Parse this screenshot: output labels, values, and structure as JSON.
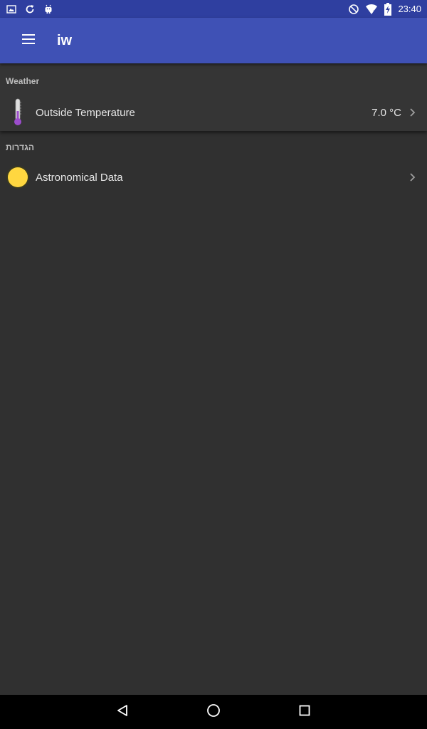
{
  "status_bar": {
    "time": "23:40",
    "left_icons": [
      "image-icon",
      "refresh-icon",
      "android-icon"
    ],
    "right_icons": [
      "do-not-disturb-icon",
      "wifi-icon",
      "battery-charging-icon"
    ]
  },
  "app_bar": {
    "title": "iw",
    "menu_icon": "menu-icon"
  },
  "sections": {
    "weather": {
      "header": "Weather",
      "item": {
        "label": "Outside Temperature",
        "value": "7.0 °C",
        "icon": "thermometer-icon"
      }
    },
    "settings": {
      "header": "הגדרות",
      "item": {
        "label": "Astronomical Data",
        "icon": "sun-icon"
      }
    }
  },
  "nav_bar": {
    "buttons": [
      "back-icon",
      "home-icon",
      "recents-icon"
    ]
  },
  "colors": {
    "status_bar": "#2f3fa0",
    "app_bar": "#3f51b5",
    "background": "#303030",
    "sun": "#ffd740"
  }
}
